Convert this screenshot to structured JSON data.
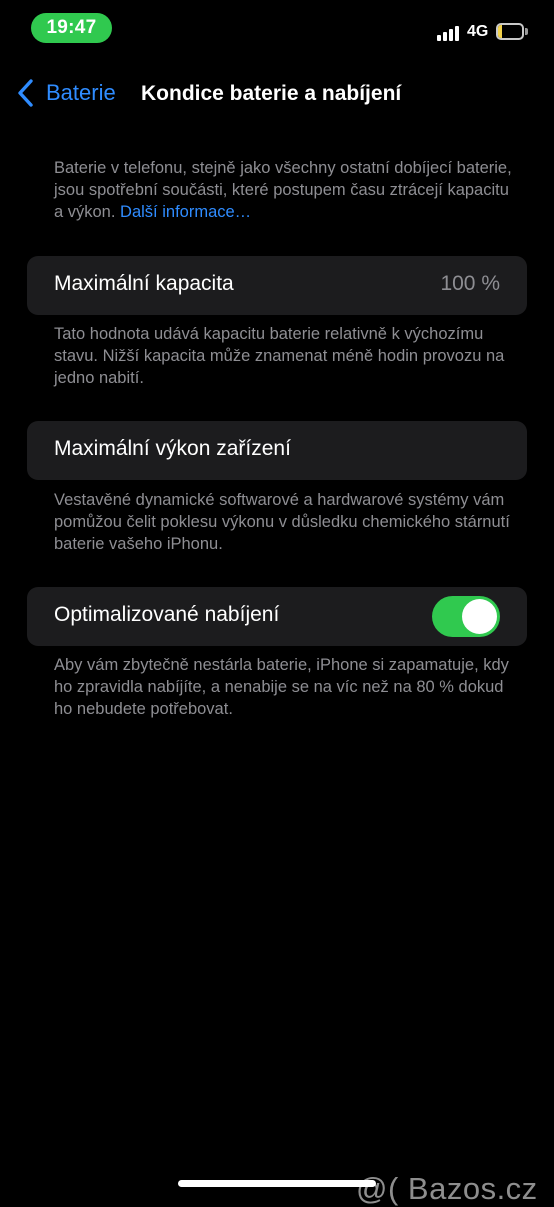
{
  "status_bar": {
    "time": "19:47",
    "network": "4G",
    "battery_level": "6",
    "battery_fraction": 0.06
  },
  "nav": {
    "back_label": "Baterie",
    "title": "Kondice baterie a nabíjení"
  },
  "intro": {
    "text": "Baterie v telefonu, stejně jako všechny ostatní dobíjecí baterie, jsou spotřební součásti, které postupem času ztrácejí kapacitu a výkon.",
    "link": "Další informace…"
  },
  "max_capacity": {
    "label": "Maximální kapacita",
    "value": "100 %",
    "description": "Tato hodnota udává kapacitu baterie relativně k výchozímu stavu. Nižší kapacita může znamenat méně hodin provozu na jedno nabití."
  },
  "peak_performance": {
    "label": "Maximální výkon zařízení",
    "description": "Vestavěné dynamické softwarové a hardwarové systémy vám pomůžou čelit poklesu výkonu v důsledku chemického stárnutí baterie vašeho iPhonu."
  },
  "optimized_charging": {
    "label": "Optimalizované nabíjení",
    "enabled": true,
    "description": "Aby vám zbytečně nestárla baterie, iPhone si zapamatuje, kdy ho zpravidla nabíjíte, a nenabije se na víc než na 80 % dokud ho nebudete potřebovat."
  },
  "watermark": "@( Bazos.cz",
  "colors": {
    "accent": "#2f8cff",
    "toggle_on": "#30c94f",
    "card_bg": "#1c1c1e",
    "secondary_text": "#8e8e93"
  }
}
